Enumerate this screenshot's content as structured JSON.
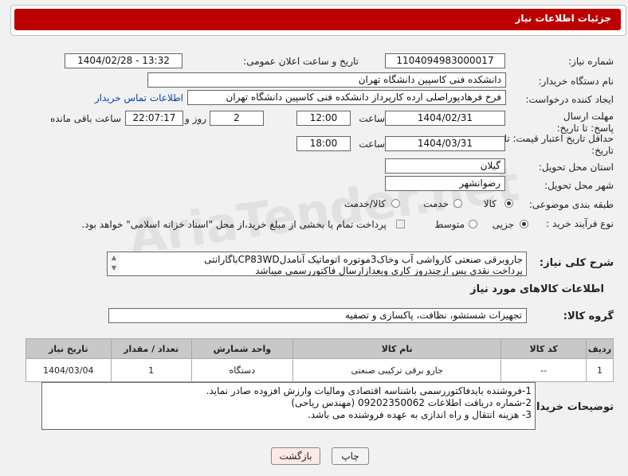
{
  "header": {
    "title": "جزئیات اطلاعات نیاز"
  },
  "form": {
    "need_number_label": "شماره نیاز:",
    "need_number": "1104094983000017",
    "announce_label": "تاریخ و ساعت اعلان عمومی:",
    "announce_value": "1404/02/28 - 13:32",
    "buyer_org_label": "نام دستگاه خریدار:",
    "buyer_org": "دانشکده فنی کاسپین دانشگاه تهران",
    "requester_label": "ایجاد کننده درخواست:",
    "requester": "فرخ فرهادپوراصلی ارده کارپرداز دانشکده فنی کاسپین دانشگاه تهران",
    "contact_link": "اطلاعات تماس خریدار",
    "deadline_label": "مهلت ارسال پاسخ: تا تاریخ:",
    "deadline_date": "1404/02/31",
    "time_label": "ساعت",
    "deadline_time": "12:00",
    "days_value": "2",
    "days_label": "روز و",
    "remaining_time": "22:07:17",
    "remaining_label": "ساعت باقی مانده",
    "validity_label": "حداقل تاریخ اعتبار قیمت: تا تاریخ:",
    "validity_date": "1404/03/31",
    "validity_time": "18:00",
    "province_label": "استان محل تحویل:",
    "province": "گیلان",
    "city_label": "شهر محل تحویل:",
    "city": "رضوانشهر",
    "category_label": "طبقه بندی موضوعی:",
    "category_options": [
      "کالا",
      "خدمت",
      "کالا/خدمت"
    ],
    "process_label": "نوع فرآیند خرید :",
    "process_options": [
      "جزیی",
      "متوسط"
    ],
    "payment_note": "پرداخت تمام یا بخشی از مبلغ خرید،از محل \"اسناد خزانه اسلامی\" خواهد بود.",
    "description_label": "شرح کلی نیاز:",
    "description_line1": "جاروبرقی صنعتی کارواشی آب وخاک3موتوره اتوماتیک آنامدلCP83WDباگارانتی",
    "description_line2": "پرداخت نقدی پس ازچندروز کاری وبعدازارسال فاکتوررسمی میباشد"
  },
  "goods": {
    "section_title": "اطلاعات کالاهای مورد نیاز",
    "group_label": "گروه کالا:",
    "group_value": "تجهیزات شستشو، نظافت، پاکسازی و تصفیه",
    "columns": [
      "ردیف",
      "کد کالا",
      "نام کالا",
      "واحد شمارش",
      "تعداد / مقدار",
      "تاریخ نیاز"
    ],
    "rows": [
      [
        "1",
        "--",
        "جارو برقی ترکیبی صنعتی",
        "دستگاه",
        "1",
        "1404/03/04"
      ]
    ]
  },
  "buyer_notes": {
    "label": "توضیحات خریدار:",
    "line1": "1-فروشنده بایدفاکتوررسمی باشناسه اقتصادی ومالیات وارزش افزوده صادر نماید.",
    "line2": "2-شماره دریافت اطلاعات 09202350062 (مهندس ریاحی)",
    "line3": "3- هزینه انتقال و راه اندازی به عهده فروشنده می باشد."
  },
  "buttons": {
    "print": "چاپ",
    "back": "بازگشت"
  },
  "colors": {
    "header": "#bc0000",
    "link": "#0645ad",
    "back_button": "#fde8e8"
  }
}
